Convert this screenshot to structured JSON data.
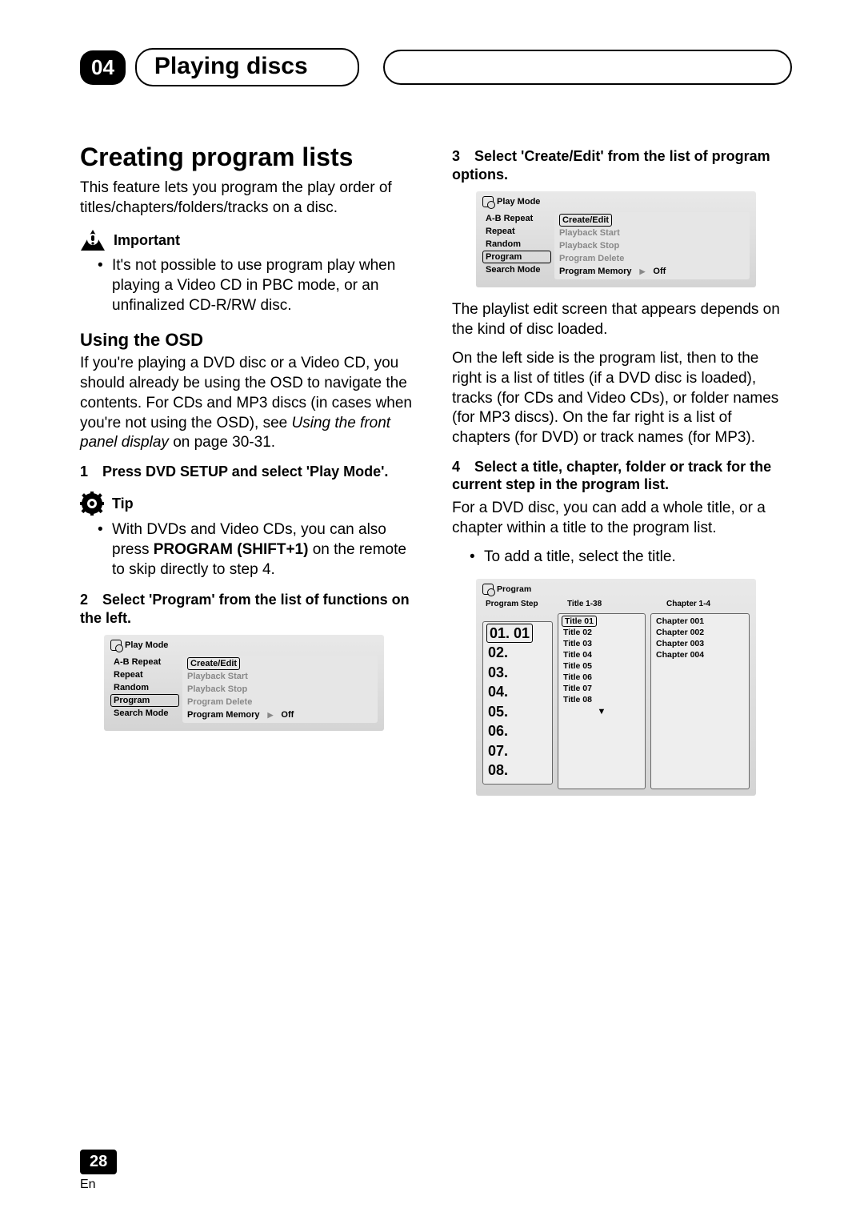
{
  "header": {
    "chapter_number": "04",
    "chapter_title": "Playing discs"
  },
  "left": {
    "h1": "Creating program lists",
    "intro": "This feature lets you program the play order of titles/chapters/folders/tracks on a disc.",
    "important_label": "Important",
    "important_body": "It's not possible to use program play when playing a Video CD in PBC mode, or an unfinalized CD-R/RW disc.",
    "h2": "Using the OSD",
    "osd_body_1": "If you're playing a DVD disc or a Video CD, you should already be using the OSD to navigate the contents. For CDs and MP3 discs (in cases when you're not using the OSD), see ",
    "osd_body_italic": "Using the front panel display",
    "osd_body_2": " on page 30-31.",
    "step1": "Press DVD SETUP and select 'Play Mode'.",
    "tip_label": "Tip",
    "tip_body_1": "With DVDs and Video CDs, you can also press ",
    "tip_body_bold": "PROGRAM (SHIFT+1)",
    "tip_body_2": " on the remote to skip directly to step 4.",
    "step2": "Select 'Program' from the list of functions on the left."
  },
  "right": {
    "step3": "Select 'Create/Edit' from the list of program options.",
    "after_osd_1": "The playlist edit screen that appears depends on the kind of disc loaded.",
    "after_osd_2": "On the left side is the program list, then to the right is a list of titles (if a DVD disc is loaded), tracks (for CDs and Video CDs), or folder names (for MP3 discs). On the far right is a list of chapters (for DVD) or track names (for MP3).",
    "step4": "Select a title, chapter, folder or track for the current step in the program list.",
    "step4_body": "For a DVD disc, you can add a whole title, or a chapter within a title to the program list.",
    "step4_bullet": "To add a title, select the title."
  },
  "osd_panel": {
    "title": "Play Mode",
    "left_items": [
      "A-B Repeat",
      "Repeat",
      "Random",
      "Program",
      "Search Mode"
    ],
    "selected_left": "Program",
    "right_items": [
      "Create/Edit",
      "Playback Start",
      "Playback Stop",
      "Program Delete"
    ],
    "selected_right": "Create/Edit",
    "memory_label": "Program Memory",
    "memory_value": "Off"
  },
  "program_panel": {
    "title": "Program",
    "col_step_head": "Program Step",
    "col_title_head": "Title 1-38",
    "col_chapter_head": "Chapter 1-4",
    "steps": [
      "01. 01",
      "02.",
      "03.",
      "04.",
      "05.",
      "06.",
      "07.",
      "08."
    ],
    "step_selected": "01. 01",
    "titles": [
      "Title 01",
      "Title 02",
      "Title 03",
      "Title 04",
      "Title 05",
      "Title 06",
      "Title 07",
      "Title 08"
    ],
    "title_selected": "Title 01",
    "chapters": [
      "Chapter 001",
      "Chapter 002",
      "Chapter 003",
      "Chapter 004"
    ]
  },
  "footer": {
    "page": "28",
    "lang": "En"
  }
}
